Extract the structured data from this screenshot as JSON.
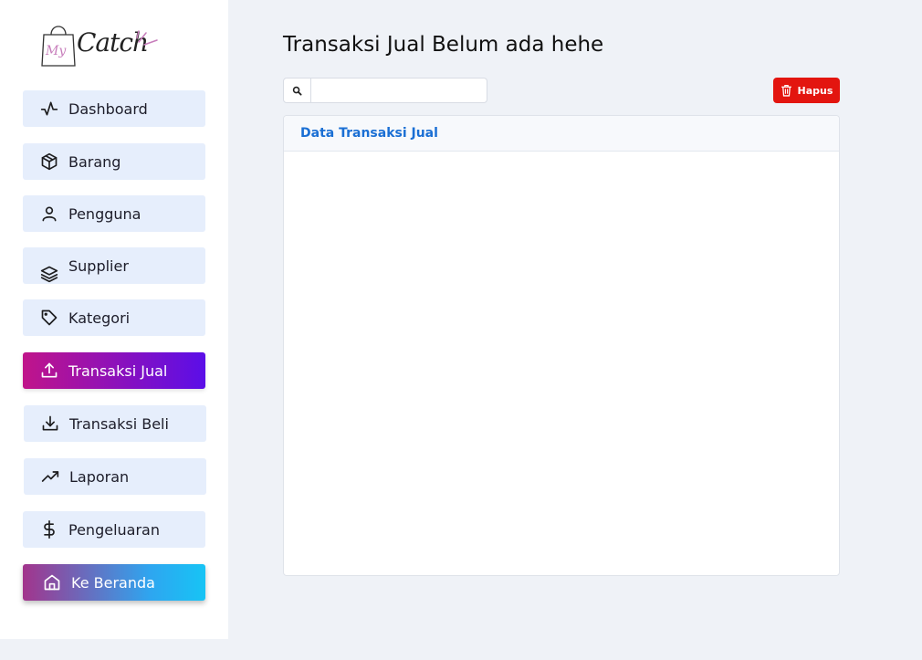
{
  "brand": {
    "logo_script": "Catch",
    "logo_prefix": "My"
  },
  "sidebar": {
    "items": [
      {
        "label": "Dashboard",
        "icon": "activity-icon"
      },
      {
        "label": "Barang",
        "icon": "box-icon"
      },
      {
        "label": "Pengguna",
        "icon": "user-icon"
      },
      {
        "label": "Supplier",
        "icon": "layers-icon"
      },
      {
        "label": "Kategori",
        "icon": "tag-icon"
      },
      {
        "label": "Transaksi Jual",
        "icon": "upload-icon",
        "active": true
      },
      {
        "label": "Transaksi Beli",
        "icon": "download-icon"
      },
      {
        "label": "Laporan",
        "icon": "trending-up-icon"
      },
      {
        "label": "Pengeluaran",
        "icon": "dollar-icon"
      },
      {
        "label": "Ke Beranda",
        "icon": "home-icon"
      }
    ]
  },
  "main": {
    "title": "Transaksi Jual Belum ada hehe",
    "search": {
      "value": "",
      "placeholder": ""
    },
    "delete_label": "Hapus",
    "card_title": "Data Transaksi Jual"
  },
  "colors": {
    "accent_blue": "#1a6fd4",
    "danger": "#e3150f",
    "active_gradient_start": "#c0148a",
    "active_gradient_end": "#5b0ee8",
    "home_gradient_start": "#a2348c",
    "home_gradient_end": "#17c4f5"
  }
}
